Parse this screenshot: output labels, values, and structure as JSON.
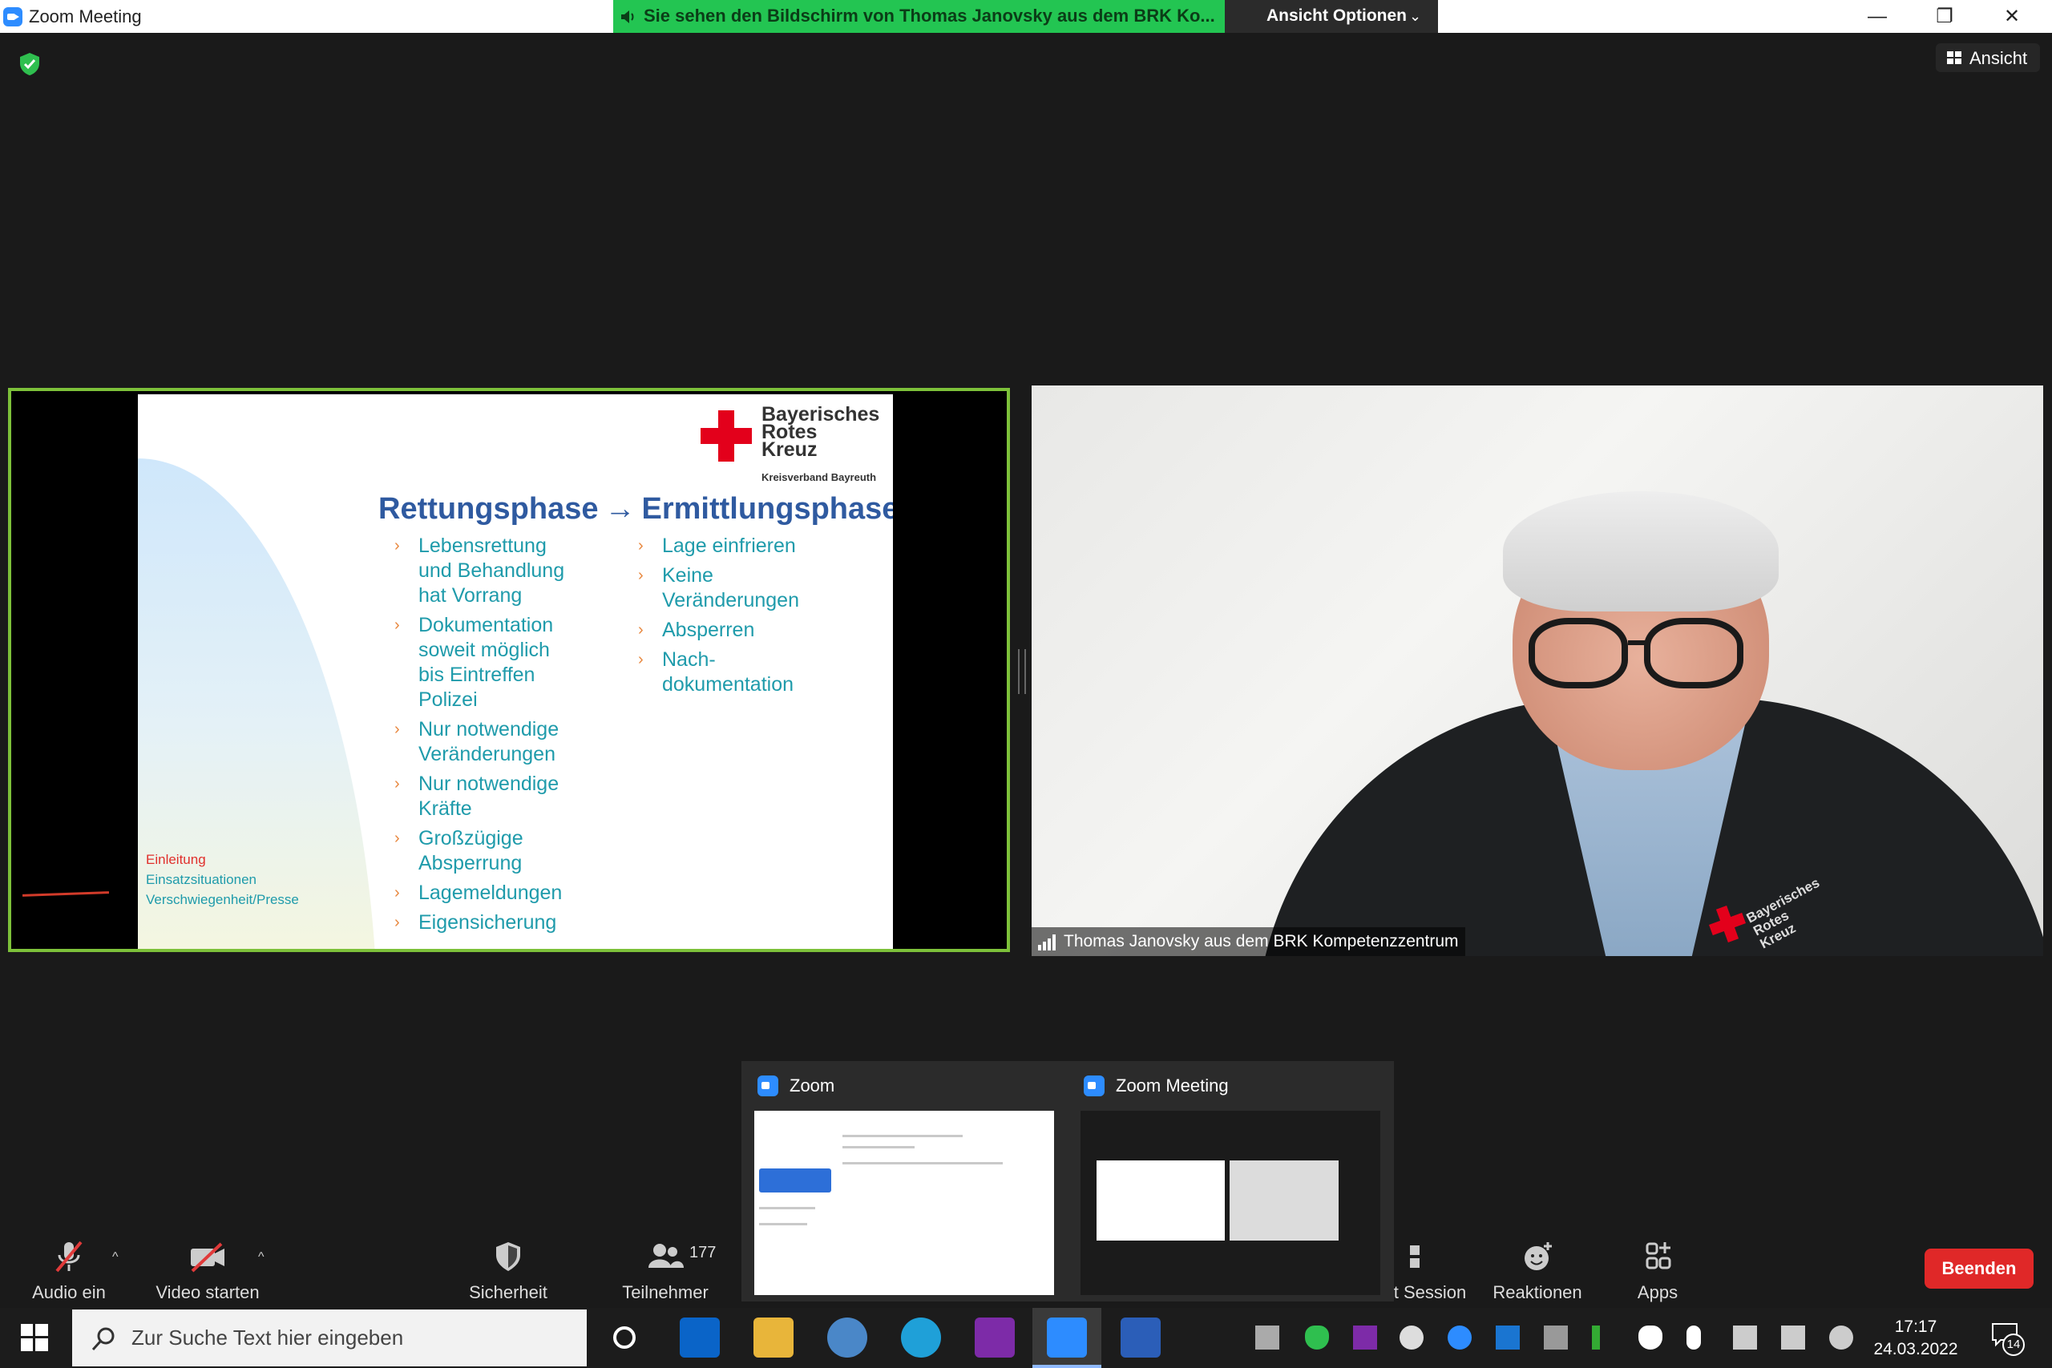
{
  "window": {
    "title": "Zoom Meeting",
    "share_banner": "Sie sehen den Bildschirm von Thomas Janovsky aus dem BRK Ko...",
    "view_options": "Ansicht Optionen",
    "view_button": "Ansicht"
  },
  "slide": {
    "logo_lines": [
      "Bayerisches",
      "Rotes",
      "Kreuz"
    ],
    "logo_sub": "Kreisverband Bayreuth",
    "heading_left": "Rettungsphase",
    "heading_arrow": "→",
    "heading_right": "Ermittlungsphase",
    "col1": [
      "Lebensrettung\nund Behandlung\nhat Vorrang",
      "Dokumentation\nsoweit möglich\nbis Eintreffen\nPolizei",
      "Nur notwendige\nVeränderungen",
      "Nur notwendige\nKräfte",
      "Großzügige\nAbsperrung",
      "Lagemeldungen",
      "Eigensicherung"
    ],
    "col2": [
      "Lage einfrieren",
      "Keine\nVeränderungen",
      "Absperren",
      "Nach-\ndokumentation"
    ],
    "nav": [
      "Einleitung",
      "Einsatzsituationen",
      "Verschwiegenheit/Presse"
    ]
  },
  "speaker": {
    "name": "Thomas Janovsky aus dem BRK Kompetenzzentrum",
    "jacket_text": "Bayerisches\nRotes\nKreuz"
  },
  "switcher": {
    "tile1": "Zoom",
    "tile2": "Zoom Meeting"
  },
  "toolbar": {
    "audio": "Audio ein",
    "video": "Video starten",
    "security": "Sicherheit",
    "participants": "Teilnehmer",
    "participants_count": "177",
    "session": "t Session",
    "reactions": "Reaktionen",
    "apps": "Apps",
    "end": "Beenden"
  },
  "taskbar": {
    "search_placeholder": "Zur Suche Text hier eingeben",
    "time": "17:17",
    "date": "24.03.2022",
    "notifications": "14"
  },
  "colors": {
    "zoom_blue": "#2d8cff",
    "share_green": "#23c552",
    "end_red": "#e02828",
    "slide_heading": "#2f5aa0",
    "slide_bullet": "#1f9bab",
    "active_border": "#7dc13a"
  }
}
